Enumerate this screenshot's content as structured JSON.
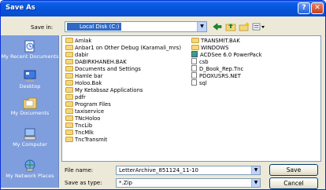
{
  "window": {
    "title": "Save As"
  },
  "title_buttons": {
    "help": "?",
    "close": "✕"
  },
  "save_in": {
    "label": "Save in:",
    "value": "Local Disk (C:)"
  },
  "toolbar_icons": [
    "back-arrow-icon",
    "up-folder-icon",
    "new-folder-icon",
    "views-menu-icon"
  ],
  "places": [
    {
      "label": "My Recent Documents",
      "icon": "recent-documents-icon"
    },
    {
      "label": "Desktop",
      "icon": "desktop-icon"
    },
    {
      "label": "My Documents",
      "icon": "my-documents-icon"
    },
    {
      "label": "My Computer",
      "icon": "my-computer-icon"
    },
    {
      "label": "My Network Places",
      "icon": "network-places-icon"
    }
  ],
  "files_col1": [
    "Amlak",
    "Anbar1 on Other Debug (Karamali_mrs)",
    "dabir",
    "DABIRKHANEH.BAK",
    "Documents and Settings",
    "Hamle bar",
    "Holoo.Bak",
    "My Ketabsaz Applications",
    "pdfr",
    "Program Files",
    "taxiservice",
    "TNcHoloo",
    "TncLib",
    "TncMlk",
    "TncTransmit"
  ],
  "files_col2": [
    {
      "name": "TRANSMIT.BAK",
      "type": "folder"
    },
    {
      "name": "WINDOWS",
      "type": "folder"
    },
    {
      "name": "ACDSee 6.0 PowerPack",
      "type": "app"
    },
    {
      "name": "csb",
      "type": "doc"
    },
    {
      "name": "D_Book_Rep.Tnc",
      "type": "doc"
    },
    {
      "name": "PDOXUSRS.NET",
      "type": "doc"
    },
    {
      "name": "sql",
      "type": "doc"
    }
  ],
  "file_name": {
    "label": "File name:",
    "value": "LetterArchive_851124_11-10"
  },
  "save_as_type": {
    "label": "Save as type:",
    "value": "*.Zip"
  },
  "buttons": {
    "save": "Save",
    "cancel": "Cancel"
  }
}
